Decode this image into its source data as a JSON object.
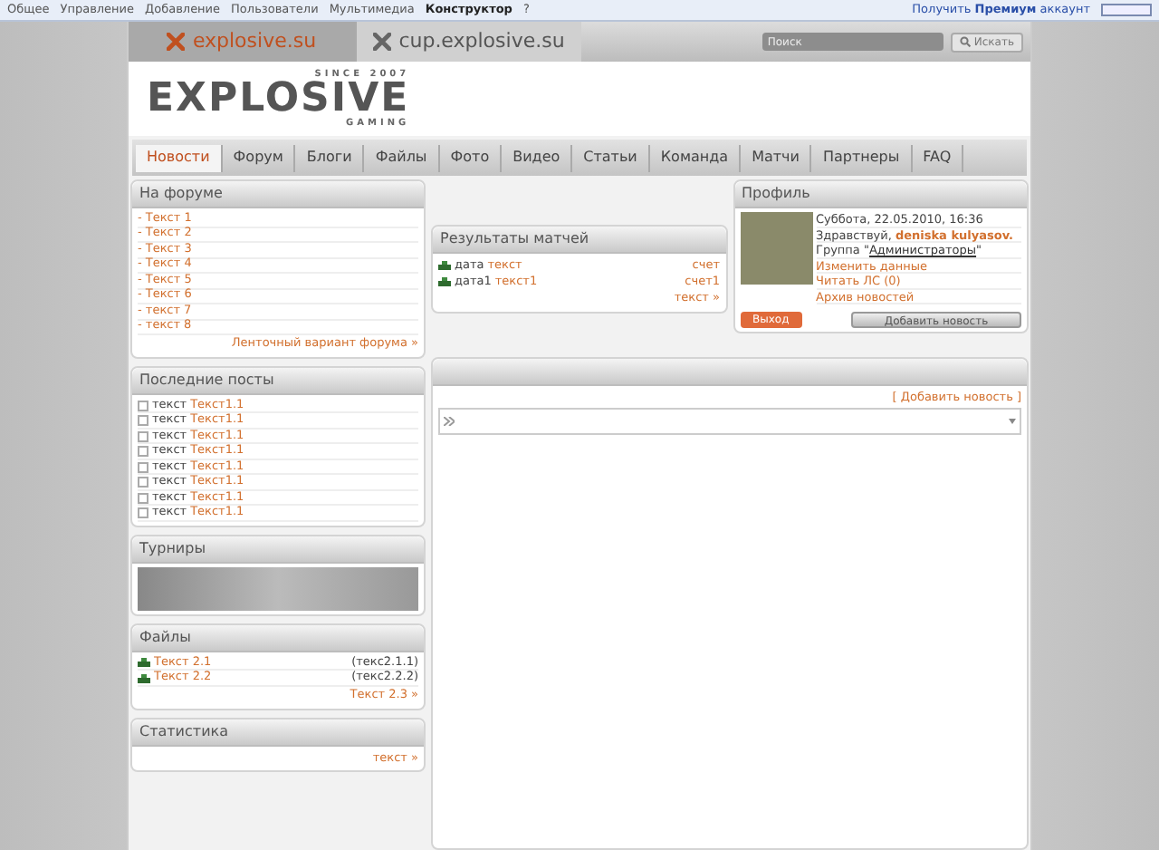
{
  "top_menu": {
    "items": [
      {
        "label": "Общее",
        "bold": false
      },
      {
        "label": "Управление",
        "bold": false
      },
      {
        "label": "Добавление",
        "bold": false
      },
      {
        "label": "Пользователи",
        "bold": false
      },
      {
        "label": "Мультимедиа",
        "bold": false
      },
      {
        "label": "Конструктор",
        "bold": true
      },
      {
        "label": "?",
        "bold": false
      }
    ],
    "premium": "Получить **Премиум** аккаунт"
  },
  "site_tabs": [
    {
      "label": "explosive.su",
      "selected": true
    },
    {
      "label": "cup.explosive.su",
      "selected": false
    }
  ],
  "search": {
    "placeholder": "Поиск",
    "button": "Искать"
  },
  "logo": {
    "text": "EXPLOSIVE",
    "tagline_top": "SINCE 2007",
    "tagline_bottom": "GAMING"
  },
  "nav": [
    {
      "label": "Новости",
      "selected": true
    },
    {
      "label": "Форум",
      "selected": false
    },
    {
      "label": "Блоги",
      "selected": false
    },
    {
      "label": "Файлы",
      "selected": false
    },
    {
      "label": "Фото",
      "selected": false
    },
    {
      "label": "Видео",
      "selected": false
    },
    {
      "label": "Статьи",
      "selected": false
    },
    {
      "label": "Команда",
      "selected": false
    },
    {
      "label": "Матчи",
      "selected": false
    },
    {
      "label": "Партнеры",
      "selected": false
    },
    {
      "label": "FAQ",
      "selected": false
    }
  ],
  "forum": {
    "title": "На форуме",
    "items": [
      "- Текст 1",
      "- Текст 2",
      "- Текст 3",
      "- Текст 4",
      "- Текст 5",
      "- Текст 6",
      "- текст 7",
      "- текст 8"
    ],
    "footer": "Ленточный вариант форума »"
  },
  "recent_posts": {
    "title": "Последние посты",
    "items": [
      {
        "text": "текст",
        "link": "Текст1.1"
      },
      {
        "text": "текст",
        "link": "Текст1.1"
      },
      {
        "text": "текст",
        "link": "Текст1.1"
      },
      {
        "text": "текст",
        "link": "Текст1.1"
      },
      {
        "text": "текст",
        "link": "Текст1.1"
      },
      {
        "text": "текст",
        "link": "Текст1.1"
      },
      {
        "text": "текст",
        "link": "Текст1.1"
      },
      {
        "text": "текст",
        "link": "Текст1.1"
      }
    ]
  },
  "tournaments": {
    "title": "Турниры"
  },
  "files": {
    "title": "Файлы",
    "items": [
      {
        "link": "Текст 2.1",
        "note": "(текс2.1.1)"
      },
      {
        "link": "Текст 2.2",
        "note": "(текс2.2.2)"
      }
    ],
    "footer": "Текст 2.3 »"
  },
  "stats": {
    "title": "Статистика",
    "footer": "текст »"
  },
  "matches": {
    "title": "Результаты матчей",
    "rows": [
      {
        "date": "дата",
        "link": "текст",
        "score": "счет"
      },
      {
        "date": "дата1",
        "link": "текст1",
        "score": "счет1"
      }
    ],
    "footer": "текст »"
  },
  "profile": {
    "title": "Профиль",
    "date": "Суббота, 22.05.2010, 16:36",
    "greeting": "Здравствуй,",
    "user": "deniska kulyasov.",
    "group_prefix": "Группа \"",
    "group": "Администраторы",
    "group_suffix": "\"",
    "links": [
      "Изменить данные",
      "Читать ЛС (0)",
      "Архив новостей"
    ],
    "logout": "Выход",
    "add_news": "Добавить новость"
  },
  "news": {
    "add_link": "[ Добавить новость ]"
  }
}
